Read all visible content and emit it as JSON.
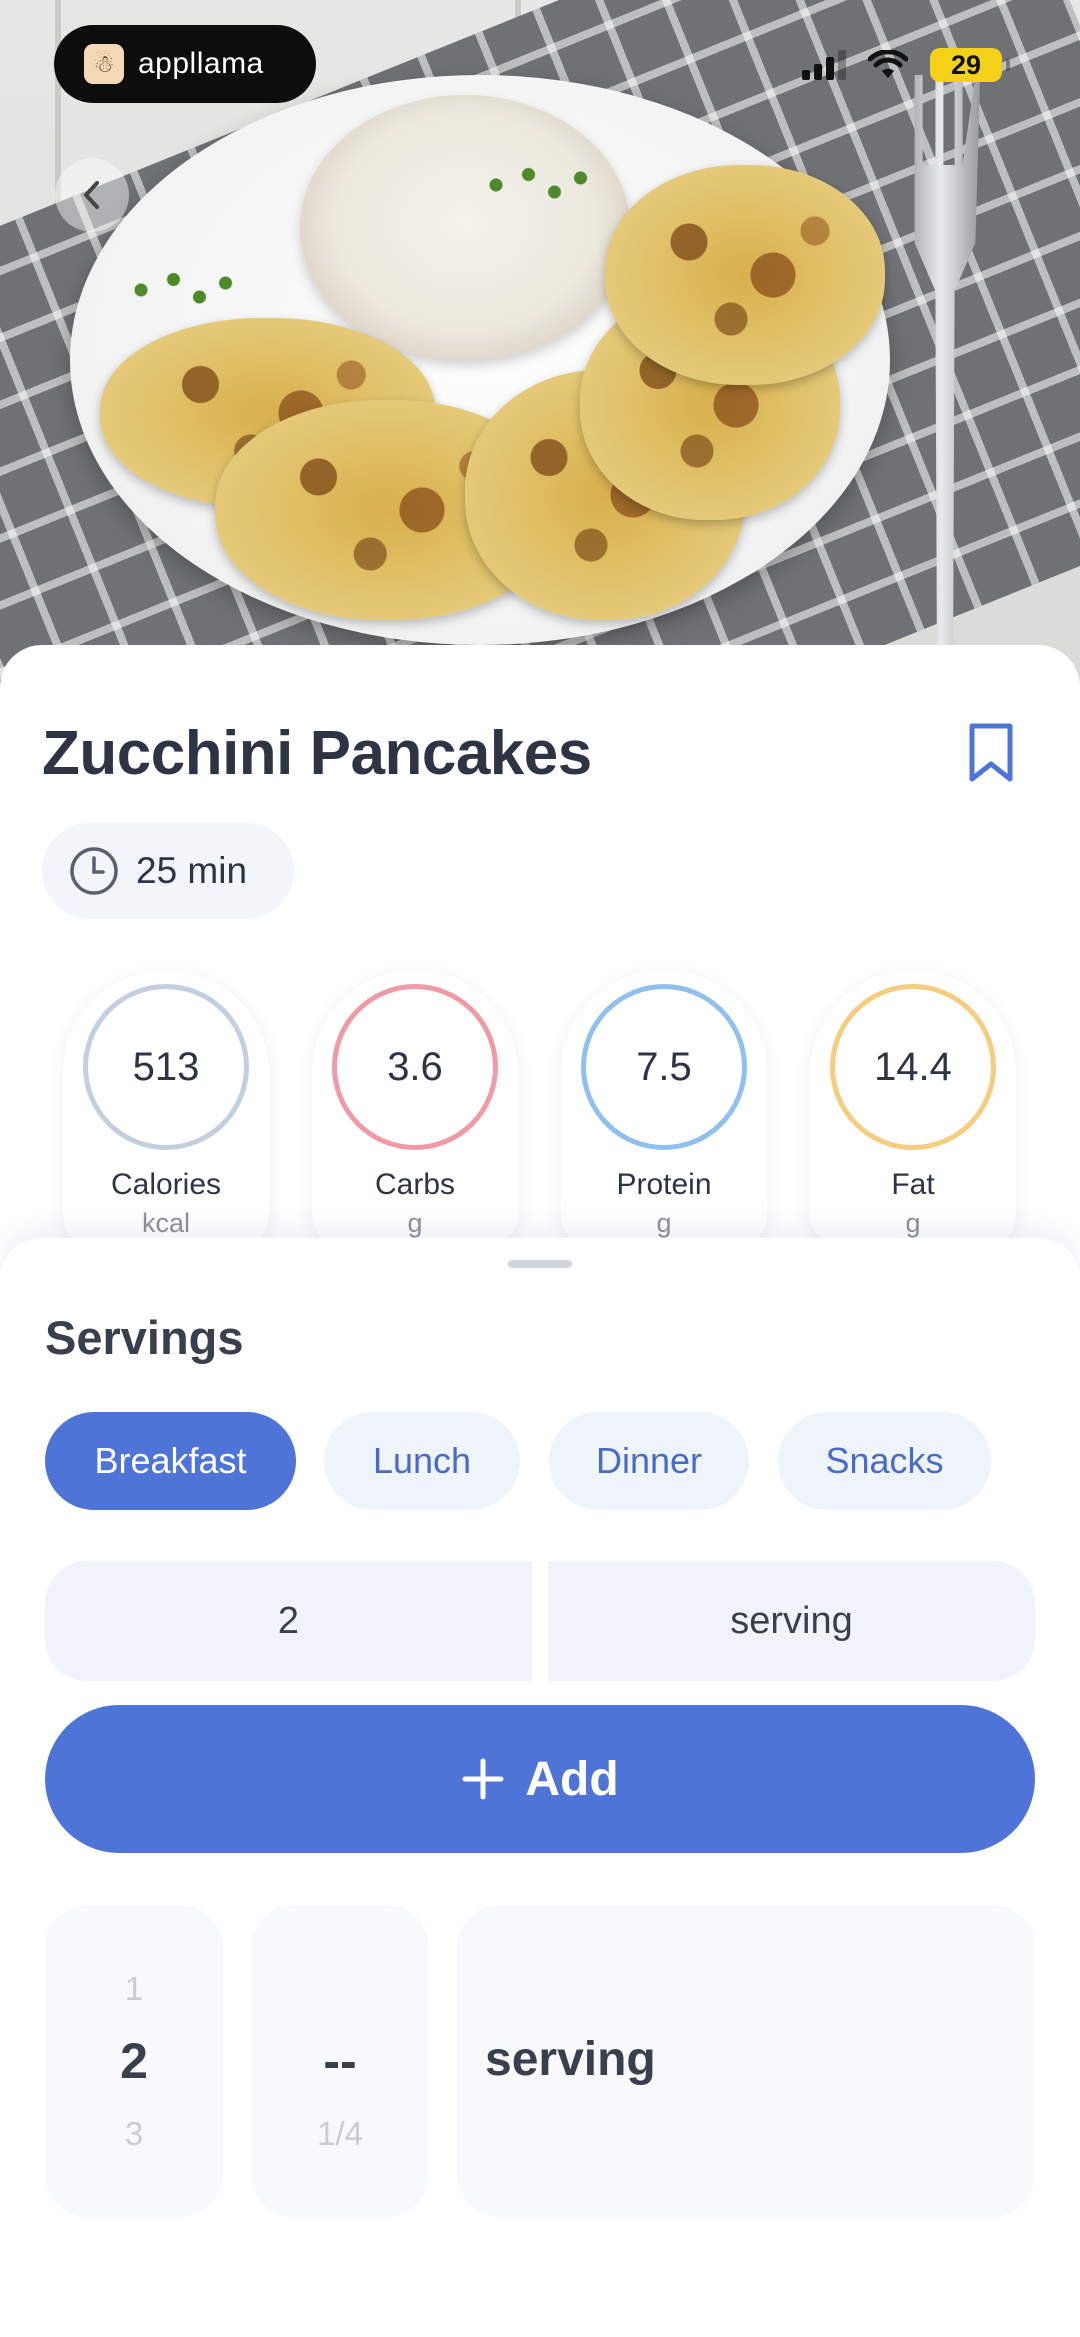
{
  "status_bar": {
    "app_name": "appllama",
    "battery": "29",
    "icons": [
      "signal-icon",
      "wifi-icon",
      "battery-icon"
    ]
  },
  "recipe": {
    "title": "Zucchini Pancakes",
    "time": "25 min"
  },
  "nutrition": [
    {
      "value": "513",
      "label": "Calories",
      "unit": "kcal",
      "color": "#c3cfe0"
    },
    {
      "value": "3.6",
      "label": "Carbs",
      "unit": "g",
      "color": "#ef9aa6"
    },
    {
      "value": "7.5",
      "label": "Protein",
      "unit": "g",
      "color": "#8fc0ef"
    },
    {
      "value": "14.4",
      "label": "Fat",
      "unit": "g",
      "color": "#f6cd7f"
    }
  ],
  "servings": {
    "title": "Servings",
    "meals": [
      "Breakfast",
      "Lunch",
      "Dinner",
      "Snacks"
    ],
    "selected_meal": "Breakfast",
    "quantity": "2",
    "unit": "serving",
    "add_label": "Add"
  },
  "picker": {
    "whole_prev": "1",
    "whole_selected": "2",
    "whole_next": "3",
    "fraction_selected": "--",
    "fraction_next": "1/4",
    "unit_selected": "serving"
  },
  "colors": {
    "accent": "#4f74d8",
    "chip_bg": "#eff3fa",
    "text_dark": "#2f3445"
  }
}
